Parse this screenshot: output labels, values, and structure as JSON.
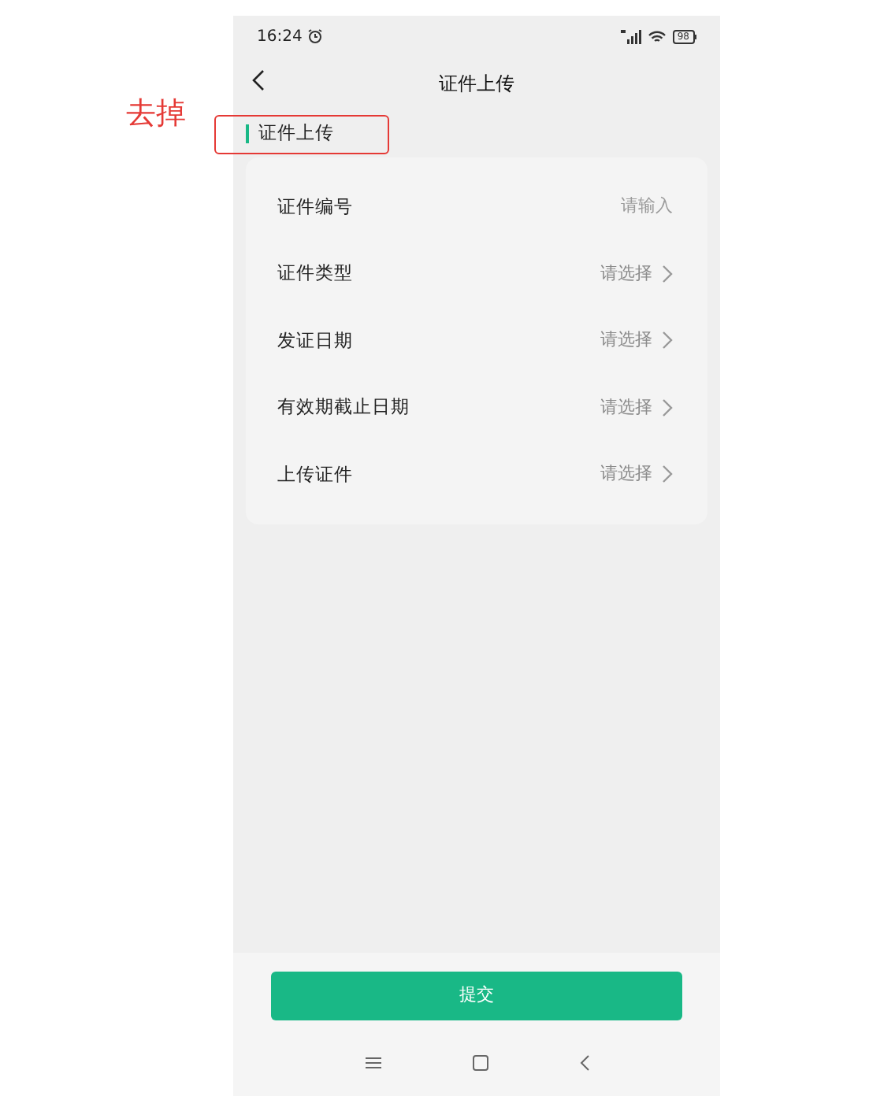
{
  "status_bar": {
    "time": "16:24",
    "battery": "98"
  },
  "nav": {
    "title": "证件上传"
  },
  "section": {
    "title": "证件上传"
  },
  "annotation": {
    "text": "去掉"
  },
  "fields": [
    {
      "label": "证件编号",
      "kind": "input",
      "placeholder": "请输入"
    },
    {
      "label": "证件类型",
      "kind": "select",
      "value": "请选择"
    },
    {
      "label": "发证日期",
      "kind": "select",
      "value": "请选择"
    },
    {
      "label": "有效期截止日期",
      "kind": "select",
      "value": "请选择"
    },
    {
      "label": "上传证件",
      "kind": "select",
      "value": "请选择"
    }
  ],
  "submit_button": "提交"
}
